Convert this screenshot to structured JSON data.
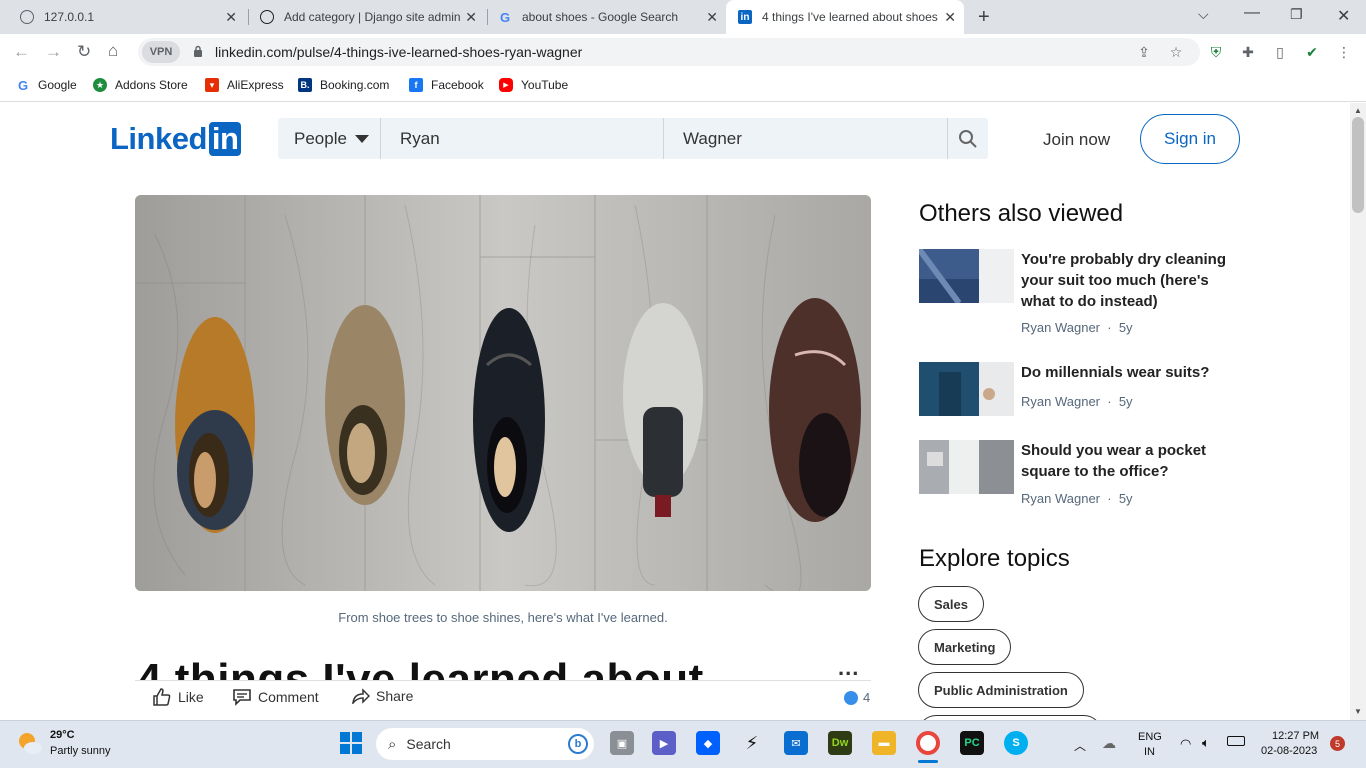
{
  "browser": {
    "tabs": [
      {
        "title": "127.0.0.1",
        "active": false
      },
      {
        "title": "Add category | Django site admin",
        "active": false
      },
      {
        "title": "about shoes - Google Search",
        "active": false
      },
      {
        "title": "4 things I've learned about shoes",
        "active": true
      }
    ],
    "new_tab": "+",
    "url": "linkedin.com/pulse/4-things-ive-learned-shoes-ryan-wagner",
    "vpn_label": "VPN",
    "bookmarks": [
      "Google",
      "Addons Store",
      "AliExpress",
      "Booking.com",
      "Facebook",
      "YouTube"
    ]
  },
  "linkedin": {
    "logo_text": "Linked",
    "logo_box": "in",
    "search": {
      "filter_label": "People",
      "first_name": "Ryan",
      "last_name": "Wagner"
    },
    "join_now": "Join now",
    "sign_in": "Sign in"
  },
  "article": {
    "caption": "From shoe trees to shoe shines, here's what I've learned.",
    "title": "4 things I've learned about",
    "more": "...",
    "actions": {
      "like": "Like",
      "comment": "Comment",
      "share": "Share"
    },
    "reaction_count": "4"
  },
  "sidebar": {
    "others_heading": "Others also viewed",
    "articles": [
      {
        "title": "You're probably dry cleaning your suit too much (here's what to do instead)",
        "author": "Ryan Wagner",
        "age": "5y"
      },
      {
        "title": "Do millennials wear suits?",
        "author": "Ryan Wagner",
        "age": "5y"
      },
      {
        "title": "Should you wear a pocket square to the office?",
        "author": "Ryan Wagner",
        "age": "5y"
      }
    ],
    "meta_sep": "·",
    "explore_heading": "Explore topics",
    "topics": [
      "Sales",
      "Marketing",
      "Public Administration"
    ]
  },
  "taskbar": {
    "weather_temp": "29°C",
    "weather_desc": "Partly sunny",
    "search_label": "Search",
    "lang_1": "ENG",
    "lang_2": "IN",
    "time": "12:27 PM",
    "date": "02-08-2023",
    "notif_count": "5"
  },
  "colors": {
    "linkedin_blue": "#0a66c2",
    "reaction_blue": "#378fe9"
  }
}
